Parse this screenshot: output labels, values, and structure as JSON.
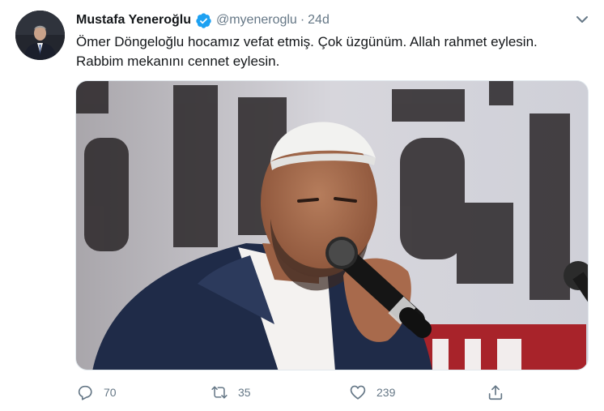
{
  "tweet": {
    "author": {
      "display_name": "Mustafa Yeneroğlu",
      "handle": "@myeneroglu",
      "verified": true
    },
    "separator": "·",
    "time": "24d",
    "text_lines": [
      "Ömer Döngeloğlu hocamız vefat etmiş. Çok üzgünüm. Allah rahmet eylesin.",
      "Rabbim mekanını cennet eylesin."
    ],
    "actions": {
      "reply_count": "70",
      "retweet_count": "35",
      "like_count": "239"
    }
  },
  "icons": {
    "verified": "verified-badge-icon",
    "caret": "chevron-down-icon",
    "reply": "speech-bubble-icon",
    "retweet": "retweet-arrows-icon",
    "like": "heart-outline-icon",
    "share": "share-upload-icon"
  },
  "colors": {
    "verified_blue": "#1da1f2",
    "muted": "#657786",
    "text": "#14171a"
  }
}
